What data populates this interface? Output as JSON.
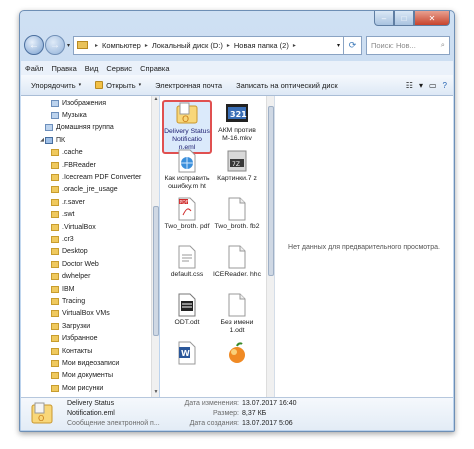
{
  "window": {
    "caption_buttons": [
      "–",
      "□",
      "✕"
    ]
  },
  "address": {
    "history": "▾",
    "crumbs": [
      "Компьютер",
      "Локальный диск (D:)",
      "Новая папка (2)"
    ],
    "crumb_sep": "▸",
    "dropdown": "▾",
    "search_placeholder": "Поиск: Нов...",
    "search_icon": "⌕"
  },
  "menubar": [
    "Файл",
    "Правка",
    "Вид",
    "Сервис",
    "Справка"
  ],
  "commands": {
    "organize": "Упорядочить",
    "open": "Открыть",
    "email": "Электронная почта",
    "burn": "Записать на оптический диск",
    "dd": "▾",
    "view_glyphs": [
      "☷",
      "▾",
      "▭",
      "?"
    ]
  },
  "tree": [
    {
      "label": "Изображения",
      "icon": "lib-icon",
      "indent": 1
    },
    {
      "label": "Музыка",
      "icon": "lib-icon",
      "indent": 1
    },
    {
      "label": "Домашняя группа",
      "icon": "homegroup-icon",
      "indent": 0
    },
    {
      "label": "ПК",
      "icon": "pc-icon",
      "indent": 0,
      "arrow": "◢"
    },
    {
      "label": ".cache",
      "icon": "folder-icon",
      "indent": 1
    },
    {
      "label": ".FBReader",
      "icon": "folder-icon",
      "indent": 1
    },
    {
      "label": ".Icecream PDF Converter",
      "icon": "folder-icon",
      "indent": 1
    },
    {
      "label": ".oracle_jre_usage",
      "icon": "folder-icon",
      "indent": 1
    },
    {
      "label": ".r.saver",
      "icon": "folder-icon",
      "indent": 1
    },
    {
      "label": ".swt",
      "icon": "folder-icon",
      "indent": 1
    },
    {
      "label": ".VirtualBox",
      "icon": "folder-icon",
      "indent": 1
    },
    {
      "label": ".cr3",
      "icon": "folder-icon",
      "indent": 1
    },
    {
      "label": "Desktop",
      "icon": "folder-icon",
      "indent": 1
    },
    {
      "label": "Doctor Web",
      "icon": "folder-icon",
      "indent": 1
    },
    {
      "label": "dwhelper",
      "icon": "folder-icon",
      "indent": 1
    },
    {
      "label": "IBM",
      "icon": "folder-icon",
      "indent": 1
    },
    {
      "label": "Tracing",
      "icon": "folder-icon",
      "indent": 1
    },
    {
      "label": "VirtualBox VMs",
      "icon": "folder-icon",
      "indent": 1
    },
    {
      "label": "Загрузки",
      "icon": "folder-icon",
      "indent": 1
    },
    {
      "label": "Избранное",
      "icon": "folder-icon",
      "indent": 1
    },
    {
      "label": "Контакты",
      "icon": "folder-icon",
      "indent": 1
    },
    {
      "label": "Мои видеозаписи",
      "icon": "folder-icon",
      "indent": 1
    },
    {
      "label": "Мои документы",
      "icon": "folder-icon",
      "indent": 1
    },
    {
      "label": "Мои рисунки",
      "icon": "folder-icon",
      "indent": 1
    }
  ],
  "files": [
    {
      "name": "Delivery Status Notificatio n.eml",
      "icon": "eml-icon",
      "selected": true
    },
    {
      "name": "АКМ против М-16.mkv",
      "icon": "video-icon"
    },
    {
      "name": "Как исправить ошибку.m ht",
      "icon": "mht-icon"
    },
    {
      "name": "Картинки.7 z",
      "icon": "archive-icon"
    },
    {
      "name": "Two_broth. pdf",
      "icon": "pdf-icon"
    },
    {
      "name": "Two_broth. fb2",
      "icon": "doc-icon"
    },
    {
      "name": "default.css",
      "icon": "css-icon"
    },
    {
      "name": "ICEReader. hhc",
      "icon": "doc-icon"
    },
    {
      "name": "ODT.odt",
      "icon": "odt-icon"
    },
    {
      "name": "Без имени 1.odt",
      "icon": "doc-icon"
    },
    {
      "name": "",
      "icon": "word-icon"
    },
    {
      "name": "",
      "icon": "image-icon"
    }
  ],
  "preview": {
    "text": "Нет данных для предварительного просмотра."
  },
  "details": {
    "filename": "Delivery Status Notification.eml",
    "type": "Сообщение электронной п...",
    "modified_key": "Дата изменения:",
    "modified_val": "13.07.2017 16:40",
    "size_key": "Размер:",
    "size_val": "8,37 КБ",
    "created_key": "Дата создания:",
    "created_val": "13.07.2017 5:06"
  }
}
